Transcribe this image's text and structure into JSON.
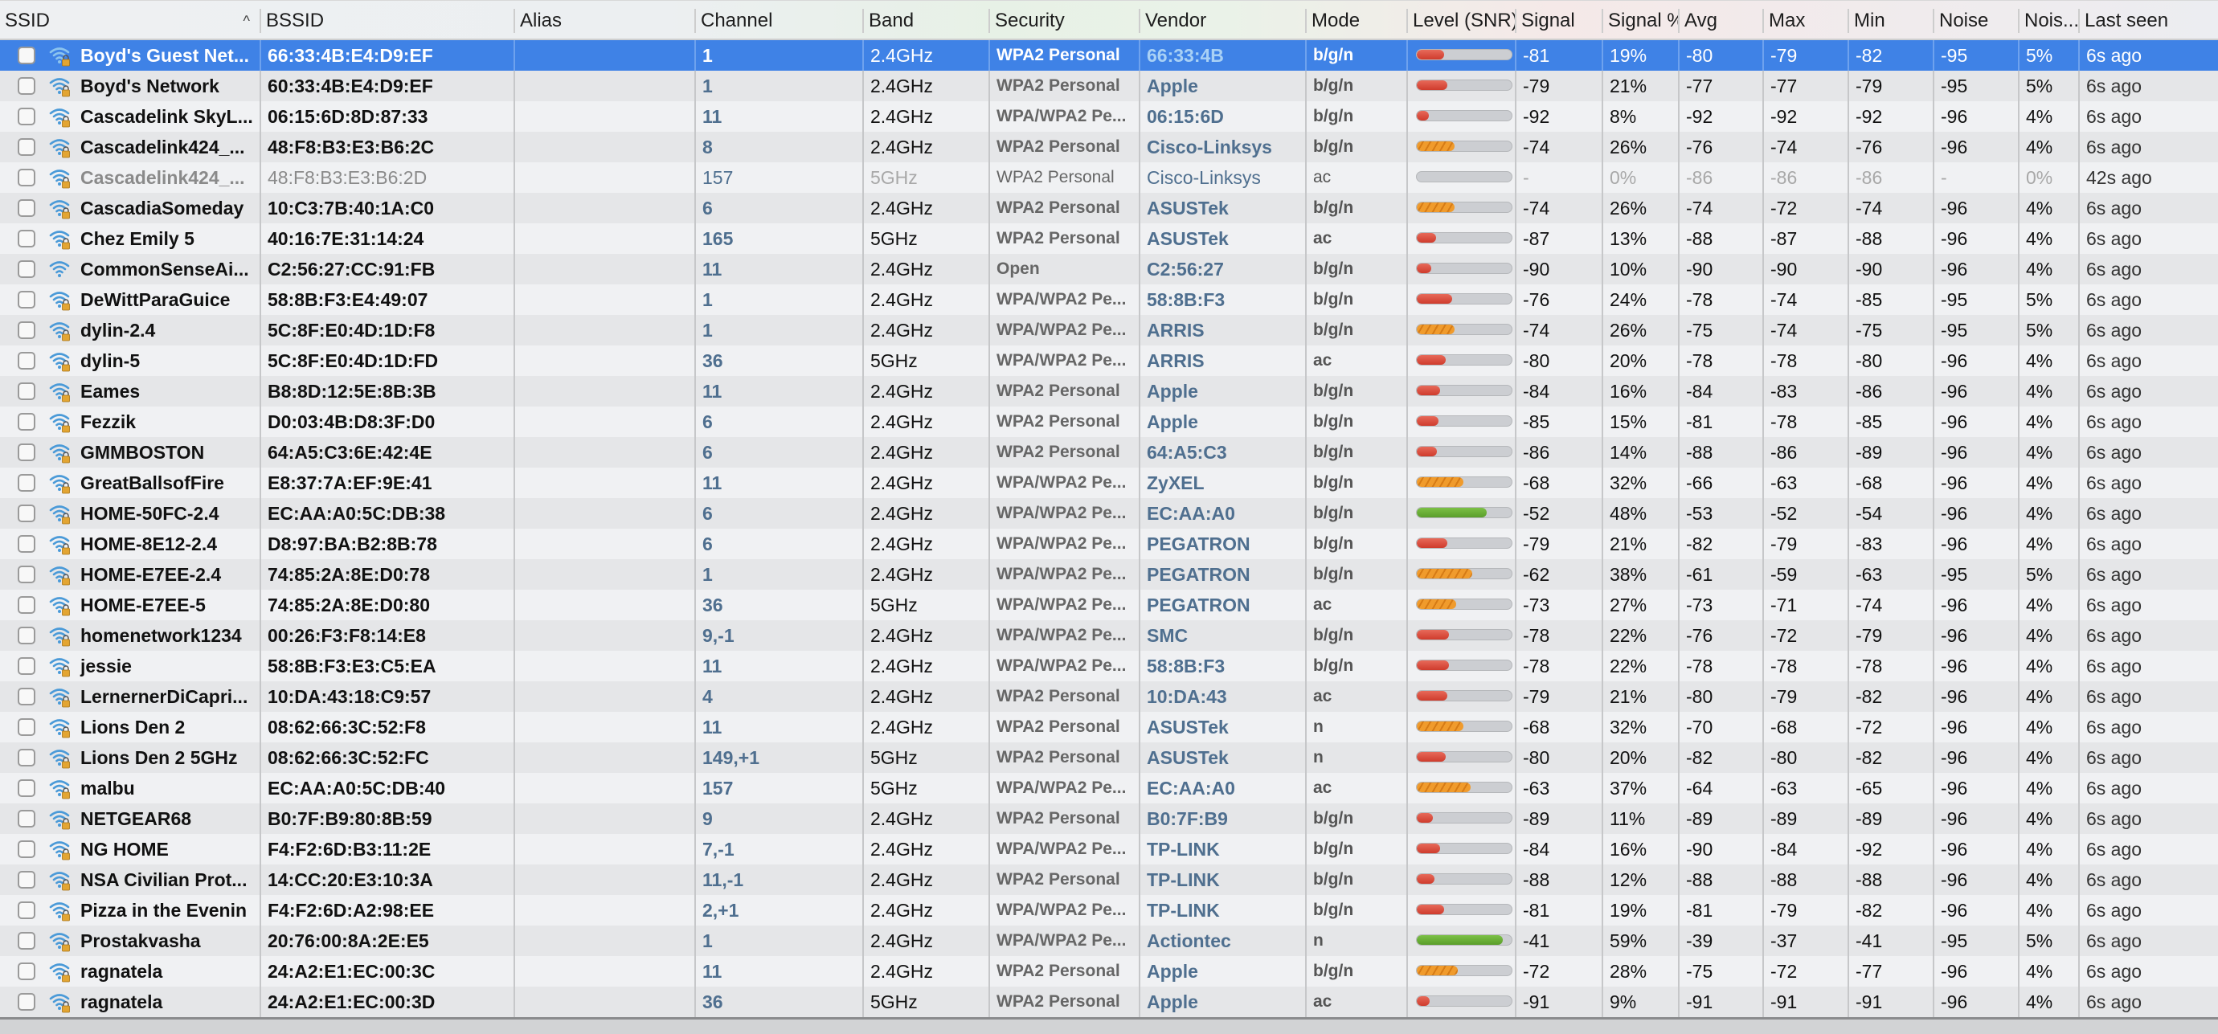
{
  "columns": [
    {
      "key": "ssid",
      "label": "SSID",
      "sorted": "ascending"
    },
    {
      "key": "bssid",
      "label": "BSSID"
    },
    {
      "key": "alias",
      "label": "Alias"
    },
    {
      "key": "channel",
      "label": "Channel"
    },
    {
      "key": "band",
      "label": "Band"
    },
    {
      "key": "security",
      "label": "Security"
    },
    {
      "key": "vendor",
      "label": "Vendor"
    },
    {
      "key": "mode",
      "label": "Mode"
    },
    {
      "key": "level",
      "label": "Level (SNR)"
    },
    {
      "key": "signal",
      "label": "Signal"
    },
    {
      "key": "sigpct",
      "label": "Signal %"
    },
    {
      "key": "avg",
      "label": "Avg"
    },
    {
      "key": "max",
      "label": "Max"
    },
    {
      "key": "min",
      "label": "Min"
    },
    {
      "key": "noise",
      "label": "Noise"
    },
    {
      "key": "noisepct",
      "label": "Nois..."
    },
    {
      "key": "lastseen",
      "label": "Last seen"
    }
  ],
  "sort_icon": "chevron-up-icon",
  "level_colors": {
    "red": "#cf3b2c",
    "orange": "#f09b2c",
    "green": "#5a9e2a"
  },
  "selection_color": "#3f82e6",
  "rows": [
    {
      "ssid": "Boyd's Guest Net...",
      "bssid": "66:33:4B:E4:D9:EF",
      "alias": "",
      "channel": "1",
      "band": "2.4GHz",
      "security": "WPA2 Personal",
      "vendor": "66:33:4B",
      "mode": "b/g/n",
      "level_pct": 19,
      "signal": "-81",
      "sigpct": "19%",
      "avg": "-80",
      "max": "-79",
      "min": "-82",
      "noise": "-95",
      "noisepct": "5%",
      "lastseen": "6s ago",
      "locked": true,
      "selected": true
    },
    {
      "ssid": "Boyd's Network",
      "bssid": "60:33:4B:E4:D9:EF",
      "alias": "",
      "channel": "1",
      "band": "2.4GHz",
      "security": "WPA2 Personal",
      "vendor": "Apple",
      "mode": "b/g/n",
      "level_pct": 21,
      "signal": "-79",
      "sigpct": "21%",
      "avg": "-77",
      "max": "-77",
      "min": "-79",
      "noise": "-95",
      "noisepct": "5%",
      "lastseen": "6s ago",
      "locked": true
    },
    {
      "ssid": "Cascadelink SkyL...",
      "bssid": "06:15:6D:8D:87:33",
      "alias": "",
      "channel": "11",
      "band": "2.4GHz",
      "security": "WPA/WPA2 Pe...",
      "vendor": "06:15:6D",
      "mode": "b/g/n",
      "level_pct": 8,
      "signal": "-92",
      "sigpct": "8%",
      "avg": "-92",
      "max": "-92",
      "min": "-92",
      "noise": "-96",
      "noisepct": "4%",
      "lastseen": "6s ago",
      "locked": true
    },
    {
      "ssid": "Cascadelink424_...",
      "bssid": "48:F8:B3:E3:B6:2C",
      "alias": "",
      "channel": "8",
      "band": "2.4GHz",
      "security": "WPA2 Personal",
      "vendor": "Cisco-Linksys",
      "mode": "b/g/n",
      "level_pct": 26,
      "signal": "-74",
      "sigpct": "26%",
      "avg": "-76",
      "max": "-74",
      "min": "-76",
      "noise": "-96",
      "noisepct": "4%",
      "lastseen": "6s ago",
      "locked": true
    },
    {
      "ssid": "Cascadelink424_...",
      "bssid": "48:F8:B3:E3:B6:2D",
      "alias": "",
      "channel": "157",
      "band": "5GHz",
      "security": "WPA2 Personal",
      "vendor": "Cisco-Linksys",
      "mode": "ac",
      "level_pct": 0,
      "signal": "-",
      "sigpct": "0%",
      "avg": "-86",
      "max": "-86",
      "min": "-86",
      "noise": "-",
      "noisepct": "0%",
      "lastseen": "42s ago",
      "locked": true,
      "stale": true
    },
    {
      "ssid": "CascadiaSomeday",
      "bssid": "10:C3:7B:40:1A:C0",
      "alias": "",
      "channel": "6",
      "band": "2.4GHz",
      "security": "WPA2 Personal",
      "vendor": "ASUSTek",
      "mode": "b/g/n",
      "level_pct": 26,
      "signal": "-74",
      "sigpct": "26%",
      "avg": "-74",
      "max": "-72",
      "min": "-74",
      "noise": "-96",
      "noisepct": "4%",
      "lastseen": "6s ago",
      "locked": true
    },
    {
      "ssid": "Chez Emily 5",
      "bssid": "40:16:7E:31:14:24",
      "alias": "",
      "channel": "165",
      "band": "5GHz",
      "security": "WPA2 Personal",
      "vendor": "ASUSTek",
      "mode": "ac",
      "level_pct": 13,
      "signal": "-87",
      "sigpct": "13%",
      "avg": "-88",
      "max": "-87",
      "min": "-88",
      "noise": "-96",
      "noisepct": "4%",
      "lastseen": "6s ago",
      "locked": true
    },
    {
      "ssid": "CommonSenseAi...",
      "bssid": "C2:56:27:CC:91:FB",
      "alias": "",
      "channel": "11",
      "band": "2.4GHz",
      "security": "Open",
      "vendor": "C2:56:27",
      "mode": "b/g/n",
      "level_pct": 10,
      "signal": "-90",
      "sigpct": "10%",
      "avg": "-90",
      "max": "-90",
      "min": "-90",
      "noise": "-96",
      "noisepct": "4%",
      "lastseen": "6s ago",
      "locked": false
    },
    {
      "ssid": "DeWittParaGuice",
      "bssid": "58:8B:F3:E4:49:07",
      "alias": "",
      "channel": "1",
      "band": "2.4GHz",
      "security": "WPA/WPA2 Pe...",
      "vendor": "58:8B:F3",
      "mode": "b/g/n",
      "level_pct": 24,
      "signal": "-76",
      "sigpct": "24%",
      "avg": "-78",
      "max": "-74",
      "min": "-85",
      "noise": "-95",
      "noisepct": "5%",
      "lastseen": "6s ago",
      "locked": true
    },
    {
      "ssid": "dylin-2.4",
      "bssid": "5C:8F:E0:4D:1D:F8",
      "alias": "",
      "channel": "1",
      "band": "2.4GHz",
      "security": "WPA/WPA2 Pe...",
      "vendor": "ARRIS",
      "mode": "b/g/n",
      "level_pct": 26,
      "signal": "-74",
      "sigpct": "26%",
      "avg": "-75",
      "max": "-74",
      "min": "-75",
      "noise": "-95",
      "noisepct": "5%",
      "lastseen": "6s ago",
      "locked": true
    },
    {
      "ssid": "dylin-5",
      "bssid": "5C:8F:E0:4D:1D:FD",
      "alias": "",
      "channel": "36",
      "band": "5GHz",
      "security": "WPA/WPA2 Pe...",
      "vendor": "ARRIS",
      "mode": "ac",
      "level_pct": 20,
      "signal": "-80",
      "sigpct": "20%",
      "avg": "-78",
      "max": "-78",
      "min": "-80",
      "noise": "-96",
      "noisepct": "4%",
      "lastseen": "6s ago",
      "locked": true
    },
    {
      "ssid": "Eames",
      "bssid": "B8:8D:12:5E:8B:3B",
      "alias": "",
      "channel": "11",
      "band": "2.4GHz",
      "security": "WPA2 Personal",
      "vendor": "Apple",
      "mode": "b/g/n",
      "level_pct": 16,
      "signal": "-84",
      "sigpct": "16%",
      "avg": "-84",
      "max": "-83",
      "min": "-86",
      "noise": "-96",
      "noisepct": "4%",
      "lastseen": "6s ago",
      "locked": true
    },
    {
      "ssid": "Fezzik",
      "bssid": "D0:03:4B:D8:3F:D0",
      "alias": "",
      "channel": "6",
      "band": "2.4GHz",
      "security": "WPA2 Personal",
      "vendor": "Apple",
      "mode": "b/g/n",
      "level_pct": 15,
      "signal": "-85",
      "sigpct": "15%",
      "avg": "-81",
      "max": "-78",
      "min": "-85",
      "noise": "-96",
      "noisepct": "4%",
      "lastseen": "6s ago",
      "locked": true
    },
    {
      "ssid": "GMMBOSTON",
      "bssid": "64:A5:C3:6E:42:4E",
      "alias": "",
      "channel": "6",
      "band": "2.4GHz",
      "security": "WPA2 Personal",
      "vendor": "64:A5:C3",
      "mode": "b/g/n",
      "level_pct": 14,
      "signal": "-86",
      "sigpct": "14%",
      "avg": "-88",
      "max": "-86",
      "min": "-89",
      "noise": "-96",
      "noisepct": "4%",
      "lastseen": "6s ago",
      "locked": true
    },
    {
      "ssid": "GreatBallsofFire",
      "bssid": "E8:37:7A:EF:9E:41",
      "alias": "",
      "channel": "11",
      "band": "2.4GHz",
      "security": "WPA/WPA2 Pe...",
      "vendor": "ZyXEL",
      "mode": "b/g/n",
      "level_pct": 32,
      "signal": "-68",
      "sigpct": "32%",
      "avg": "-66",
      "max": "-63",
      "min": "-68",
      "noise": "-96",
      "noisepct": "4%",
      "lastseen": "6s ago",
      "locked": true
    },
    {
      "ssid": "HOME-50FC-2.4",
      "bssid": "EC:AA:A0:5C:DB:38",
      "alias": "",
      "channel": "6",
      "band": "2.4GHz",
      "security": "WPA/WPA2 Pe...",
      "vendor": "EC:AA:A0",
      "mode": "b/g/n",
      "level_pct": 48,
      "signal": "-52",
      "sigpct": "48%",
      "avg": "-53",
      "max": "-52",
      "min": "-54",
      "noise": "-96",
      "noisepct": "4%",
      "lastseen": "6s ago",
      "locked": true
    },
    {
      "ssid": "HOME-8E12-2.4",
      "bssid": "D8:97:BA:B2:8B:78",
      "alias": "",
      "channel": "6",
      "band": "2.4GHz",
      "security": "WPA/WPA2 Pe...",
      "vendor": "PEGATRON",
      "mode": "b/g/n",
      "level_pct": 21,
      "signal": "-79",
      "sigpct": "21%",
      "avg": "-82",
      "max": "-79",
      "min": "-83",
      "noise": "-96",
      "noisepct": "4%",
      "lastseen": "6s ago",
      "locked": true
    },
    {
      "ssid": "HOME-E7EE-2.4",
      "bssid": "74:85:2A:8E:D0:78",
      "alias": "",
      "channel": "1",
      "band": "2.4GHz",
      "security": "WPA/WPA2 Pe...",
      "vendor": "PEGATRON",
      "mode": "b/g/n",
      "level_pct": 38,
      "signal": "-62",
      "sigpct": "38%",
      "avg": "-61",
      "max": "-59",
      "min": "-63",
      "noise": "-95",
      "noisepct": "5%",
      "lastseen": "6s ago",
      "locked": true
    },
    {
      "ssid": "HOME-E7EE-5",
      "bssid": "74:85:2A:8E:D0:80",
      "alias": "",
      "channel": "36",
      "band": "5GHz",
      "security": "WPA/WPA2 Pe...",
      "vendor": "PEGATRON",
      "mode": "ac",
      "level_pct": 27,
      "signal": "-73",
      "sigpct": "27%",
      "avg": "-73",
      "max": "-71",
      "min": "-74",
      "noise": "-96",
      "noisepct": "4%",
      "lastseen": "6s ago",
      "locked": true
    },
    {
      "ssid": "homenetwork1234",
      "bssid": "00:26:F3:F8:14:E8",
      "alias": "",
      "channel": "9,-1",
      "band": "2.4GHz",
      "security": "WPA/WPA2 Pe...",
      "vendor": "SMC",
      "mode": "b/g/n",
      "level_pct": 22,
      "signal": "-78",
      "sigpct": "22%",
      "avg": "-76",
      "max": "-72",
      "min": "-79",
      "noise": "-96",
      "noisepct": "4%",
      "lastseen": "6s ago",
      "locked": true
    },
    {
      "ssid": "jessie",
      "bssid": "58:8B:F3:E3:C5:EA",
      "alias": "",
      "channel": "11",
      "band": "2.4GHz",
      "security": "WPA/WPA2 Pe...",
      "vendor": "58:8B:F3",
      "mode": "b/g/n",
      "level_pct": 22,
      "signal": "-78",
      "sigpct": "22%",
      "avg": "-78",
      "max": "-78",
      "min": "-78",
      "noise": "-96",
      "noisepct": "4%",
      "lastseen": "6s ago",
      "locked": true
    },
    {
      "ssid": "LernernerDiCapri...",
      "bssid": "10:DA:43:18:C9:57",
      "alias": "",
      "channel": "4",
      "band": "2.4GHz",
      "security": "WPA2 Personal",
      "vendor": "10:DA:43",
      "mode": "ac",
      "level_pct": 21,
      "signal": "-79",
      "sigpct": "21%",
      "avg": "-80",
      "max": "-79",
      "min": "-82",
      "noise": "-96",
      "noisepct": "4%",
      "lastseen": "6s ago",
      "locked": true
    },
    {
      "ssid": "Lions Den 2",
      "bssid": "08:62:66:3C:52:F8",
      "alias": "",
      "channel": "11",
      "band": "2.4GHz",
      "security": "WPA2 Personal",
      "vendor": "ASUSTek",
      "mode": "n",
      "level_pct": 32,
      "signal": "-68",
      "sigpct": "32%",
      "avg": "-70",
      "max": "-68",
      "min": "-72",
      "noise": "-96",
      "noisepct": "4%",
      "lastseen": "6s ago",
      "locked": true
    },
    {
      "ssid": "Lions Den 2 5GHz",
      "bssid": "08:62:66:3C:52:FC",
      "alias": "",
      "channel": "149,+1",
      "band": "5GHz",
      "security": "WPA2 Personal",
      "vendor": "ASUSTek",
      "mode": "n",
      "level_pct": 20,
      "signal": "-80",
      "sigpct": "20%",
      "avg": "-82",
      "max": "-80",
      "min": "-82",
      "noise": "-96",
      "noisepct": "4%",
      "lastseen": "6s ago",
      "locked": true
    },
    {
      "ssid": "malbu",
      "bssid": "EC:AA:A0:5C:DB:40",
      "alias": "",
      "channel": "157",
      "band": "5GHz",
      "security": "WPA/WPA2 Pe...",
      "vendor": "EC:AA:A0",
      "mode": "ac",
      "level_pct": 37,
      "signal": "-63",
      "sigpct": "37%",
      "avg": "-64",
      "max": "-63",
      "min": "-65",
      "noise": "-96",
      "noisepct": "4%",
      "lastseen": "6s ago",
      "locked": true
    },
    {
      "ssid": "NETGEAR68",
      "bssid": "B0:7F:B9:80:8B:59",
      "alias": "",
      "channel": "9",
      "band": "2.4GHz",
      "security": "WPA2 Personal",
      "vendor": "B0:7F:B9",
      "mode": "b/g/n",
      "level_pct": 11,
      "signal": "-89",
      "sigpct": "11%",
      "avg": "-89",
      "max": "-89",
      "min": "-89",
      "noise": "-96",
      "noisepct": "4%",
      "lastseen": "6s ago",
      "locked": true
    },
    {
      "ssid": "NG HOME",
      "bssid": "F4:F2:6D:B3:11:2E",
      "alias": "",
      "channel": "7,-1",
      "band": "2.4GHz",
      "security": "WPA/WPA2 Pe...",
      "vendor": "TP-LINK",
      "mode": "b/g/n",
      "level_pct": 16,
      "signal": "-84",
      "sigpct": "16%",
      "avg": "-90",
      "max": "-84",
      "min": "-92",
      "noise": "-96",
      "noisepct": "4%",
      "lastseen": "6s ago",
      "locked": true
    },
    {
      "ssid": "NSA Civilian Prot...",
      "bssid": "14:CC:20:E3:10:3A",
      "alias": "",
      "channel": "11,-1",
      "band": "2.4GHz",
      "security": "WPA2 Personal",
      "vendor": "TP-LINK",
      "mode": "b/g/n",
      "level_pct": 12,
      "signal": "-88",
      "sigpct": "12%",
      "avg": "-88",
      "max": "-88",
      "min": "-88",
      "noise": "-96",
      "noisepct": "4%",
      "lastseen": "6s ago",
      "locked": true
    },
    {
      "ssid": "Pizza in the Evenin",
      "bssid": "F4:F2:6D:A2:98:EE",
      "alias": "",
      "channel": "2,+1",
      "band": "2.4GHz",
      "security": "WPA/WPA2 Pe...",
      "vendor": "TP-LINK",
      "mode": "b/g/n",
      "level_pct": 19,
      "signal": "-81",
      "sigpct": "19%",
      "avg": "-81",
      "max": "-79",
      "min": "-82",
      "noise": "-96",
      "noisepct": "4%",
      "lastseen": "6s ago",
      "locked": true
    },
    {
      "ssid": "Prostakvasha",
      "bssid": "20:76:00:8A:2E:E5",
      "alias": "",
      "channel": "1",
      "band": "2.4GHz",
      "security": "WPA/WPA2 Pe...",
      "vendor": "Actiontec",
      "mode": "n",
      "level_pct": 59,
      "signal": "-41",
      "sigpct": "59%",
      "avg": "-39",
      "max": "-37",
      "min": "-41",
      "noise": "-95",
      "noisepct": "5%",
      "lastseen": "6s ago",
      "locked": true
    },
    {
      "ssid": "ragnatela",
      "bssid": "24:A2:E1:EC:00:3C",
      "alias": "",
      "channel": "11",
      "band": "2.4GHz",
      "security": "WPA2 Personal",
      "vendor": "Apple",
      "mode": "b/g/n",
      "level_pct": 28,
      "signal": "-72",
      "sigpct": "28%",
      "avg": "-75",
      "max": "-72",
      "min": "-77",
      "noise": "-96",
      "noisepct": "4%",
      "lastseen": "6s ago",
      "locked": true
    },
    {
      "ssid": "ragnatela",
      "bssid": "24:A2:E1:EC:00:3D",
      "alias": "",
      "channel": "36",
      "band": "5GHz",
      "security": "WPA2 Personal",
      "vendor": "Apple",
      "mode": "ac",
      "level_pct": 9,
      "signal": "-91",
      "sigpct": "9%",
      "avg": "-91",
      "max": "-91",
      "min": "-91",
      "noise": "-96",
      "noisepct": "4%",
      "lastseen": "6s ago",
      "locked": true
    }
  ]
}
